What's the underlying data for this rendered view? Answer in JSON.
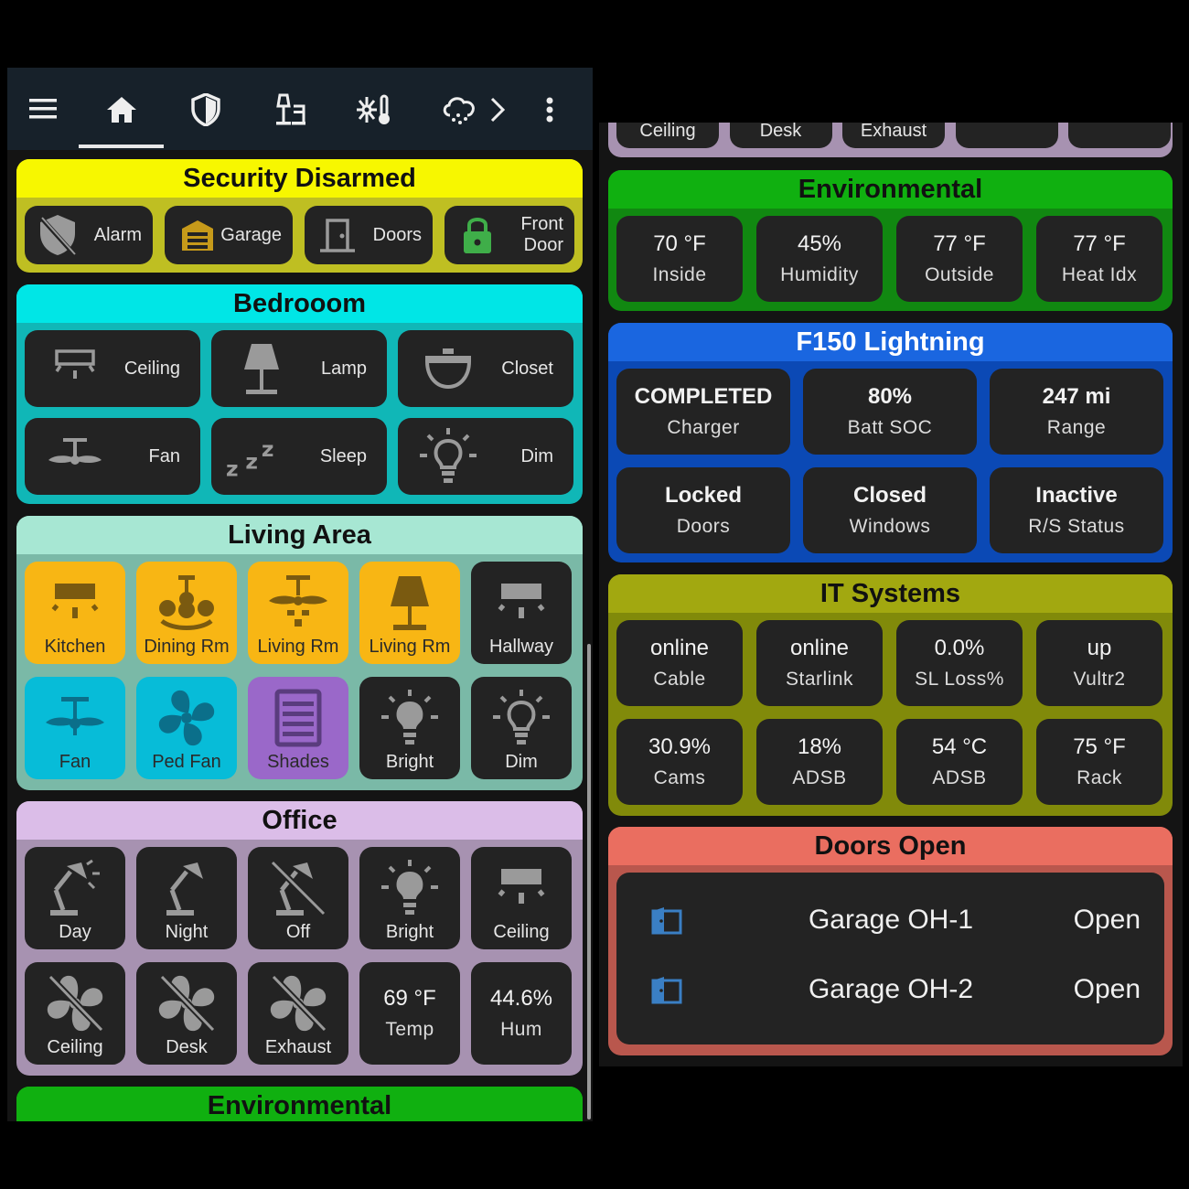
{
  "nav": {
    "icons": [
      "menu-icon",
      "home-icon",
      "shield-icon",
      "lamp-icon",
      "thermostat-icon",
      "weather-icon",
      "chevron-right-icon",
      "more-vert-icon"
    ]
  },
  "security": {
    "title": "Security Disarmed",
    "color": "#f7f700",
    "body_color": "#bfbf22",
    "buttons": [
      {
        "label": "Alarm",
        "icon": "shield-off-icon"
      },
      {
        "label": "Garage",
        "icon": "garage-icon"
      },
      {
        "label": "Doors",
        "icon": "door-icon"
      },
      {
        "label_line1": "Front",
        "label_line2": "Door",
        "icon": "lock-icon",
        "icon_color": "#3fae49"
      }
    ]
  },
  "bedroom": {
    "title": "Bedrooom",
    "color": "#00e6e6",
    "body_color": "#10b7b7",
    "buttons": [
      {
        "label": "Ceiling",
        "icon": "ceiling-light-icon"
      },
      {
        "label": "Lamp",
        "icon": "lamp-icon"
      },
      {
        "label": "Closet",
        "icon": "dome-light-icon"
      },
      {
        "label": "Fan",
        "icon": "ceiling-fan-icon"
      },
      {
        "label": "Sleep",
        "icon": "sleep-icon"
      },
      {
        "label": "Dim",
        "icon": "bulb-icon"
      }
    ]
  },
  "living": {
    "title": "Living Area",
    "color": "#a7e7d3",
    "body_color": "#7ab9a7",
    "tiles": [
      {
        "label": "Kitchen",
        "icon": "ceiling-light-icon",
        "bg": "#f8b614"
      },
      {
        "label": "Dining Rm",
        "icon": "chandelier-icon",
        "bg": "#f8b614"
      },
      {
        "label": "Living Rm",
        "icon": "ceiling-fan-light-icon",
        "bg": "#f8b614"
      },
      {
        "label": "Living Rm",
        "icon": "lamp-icon",
        "bg": "#f8b614"
      },
      {
        "label": "Hallway",
        "icon": "ceiling-light-icon",
        "bg": "#232323"
      },
      {
        "label": "Fan",
        "icon": "ceiling-fan-icon",
        "bg": "#07bcd8"
      },
      {
        "label": "Ped Fan",
        "icon": "fan-icon",
        "bg": "#07bcd8"
      },
      {
        "label": "Shades",
        "icon": "blinds-icon",
        "bg": "#9a68c9"
      },
      {
        "label": "Bright",
        "icon": "bulb-icon",
        "bg": "#232323"
      },
      {
        "label": "Dim",
        "icon": "bulb-outline-icon",
        "bg": "#232323"
      }
    ]
  },
  "office": {
    "title": "Office",
    "color": "#dbbde8",
    "body_color": "#a792b1",
    "tiles": [
      {
        "label": "Day",
        "icon": "desk-lamp-on-icon"
      },
      {
        "label": "Night",
        "icon": "desk-lamp-icon"
      },
      {
        "label": "Off",
        "icon": "desk-lamp-off-icon"
      },
      {
        "label": "Bright",
        "icon": "bulb-icon"
      },
      {
        "label": "Ceiling",
        "icon": "ceiling-light-icon"
      },
      {
        "label": "Ceiling",
        "icon": "fan-off-icon"
      },
      {
        "label": "Desk",
        "icon": "fan-off-icon"
      },
      {
        "label": "Exhaust",
        "icon": "fan-off-icon"
      },
      {
        "value": "69 °F",
        "label": "Temp"
      },
      {
        "value": "44.6%",
        "label": "Hum"
      }
    ]
  },
  "env_left": {
    "title": "Environmental",
    "color": "#10b010"
  },
  "right_top_strip": {
    "color": "#a792b1",
    "labels": [
      "Ceiling",
      "Desk",
      "Exhaust",
      "",
      ""
    ]
  },
  "environmental": {
    "title": "Environmental",
    "color": "#10b010",
    "body_color": "#118811",
    "stats": [
      {
        "value": "70 °F",
        "label": "Inside"
      },
      {
        "value": "45%",
        "label": "Humidity"
      },
      {
        "value": "77 °F",
        "label": "Outside"
      },
      {
        "value": "77 °F",
        "label": "Heat Idx"
      }
    ]
  },
  "f150": {
    "title": "F150 Lightning",
    "color": "#1a66e0",
    "body_color": "#0b49b5",
    "title_color": "#ffffff",
    "stats": [
      {
        "value": "COMPLETED",
        "label": "Charger"
      },
      {
        "value": "80%",
        "label": "Batt SOC"
      },
      {
        "value": "247 mi",
        "label": "Range"
      },
      {
        "value": "Locked",
        "label": "Doors"
      },
      {
        "value": "Closed",
        "label": "Windows"
      },
      {
        "value": "Inactive",
        "label": "R/S Status"
      }
    ]
  },
  "it": {
    "title": "IT Systems",
    "color": "#a2a810",
    "body_color": "#818a0a",
    "stats": [
      {
        "value": "online",
        "label": "Cable"
      },
      {
        "value": "online",
        "label": "Starlink"
      },
      {
        "value": "0.0%",
        "label": "SL Loss%"
      },
      {
        "value": "up",
        "label": "Vultr2"
      },
      {
        "value": "30.9%",
        "label": "Cams"
      },
      {
        "value": "18%",
        "label": "ADSB"
      },
      {
        "value": "54 °C",
        "label": "ADSB"
      },
      {
        "value": "75 °F",
        "label": "Rack"
      }
    ]
  },
  "doors_open": {
    "title": "Doors Open",
    "color": "#ea6e60",
    "body_color": "#b9574d",
    "rows": [
      {
        "name": "Garage OH-1",
        "state": "Open",
        "icon": "door-open-icon"
      },
      {
        "name": "Garage OH-2",
        "state": "Open",
        "icon": "door-open-icon"
      }
    ]
  }
}
